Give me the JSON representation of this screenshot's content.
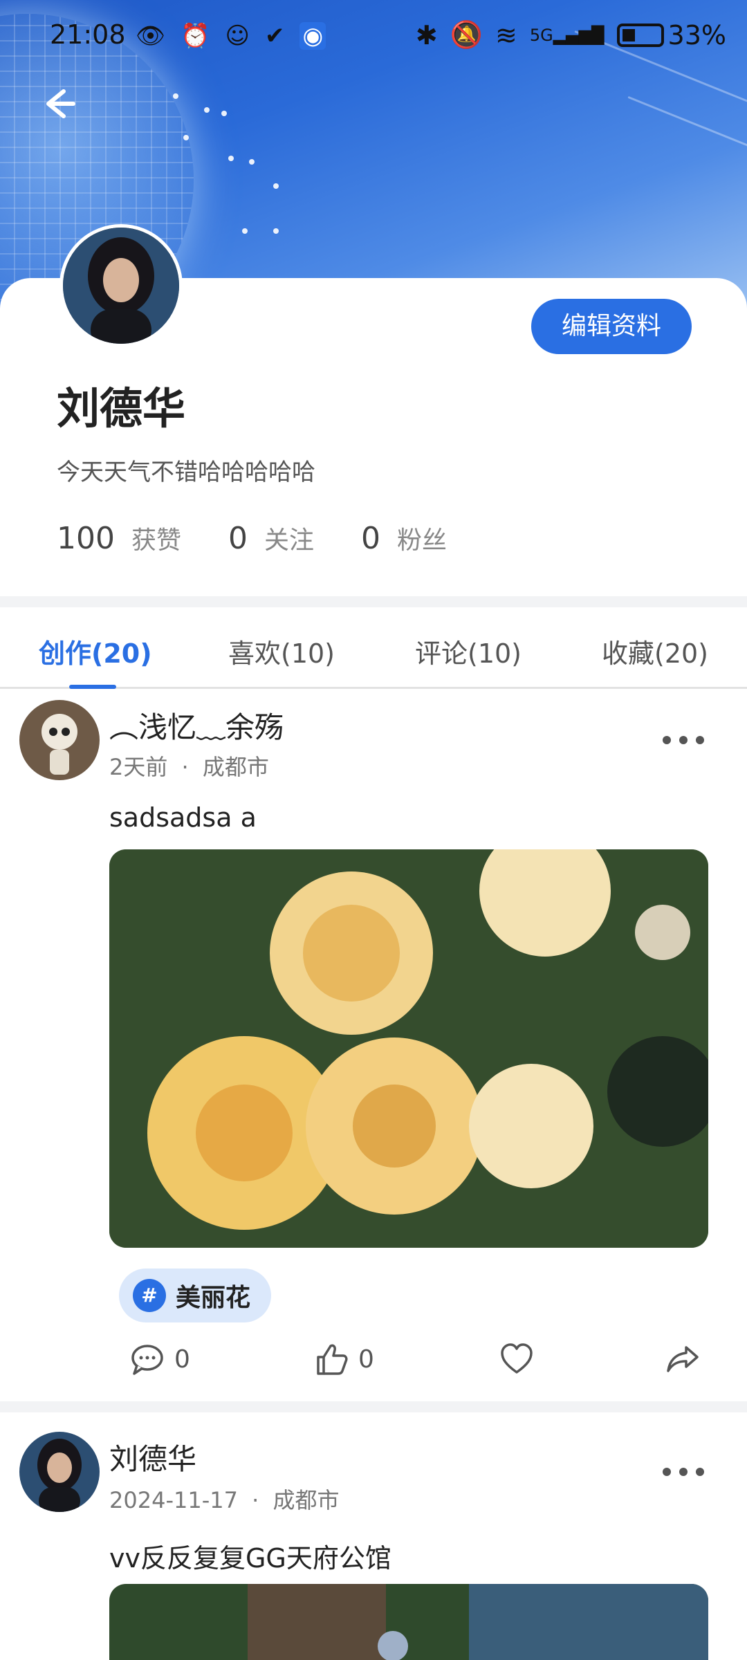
{
  "status_bar": {
    "time": "21:08",
    "battery": "33%",
    "network": "5G"
  },
  "header": {
    "back_icon": "back-arrow-icon",
    "accent_color": "#2a6fe3"
  },
  "profile": {
    "name": "刘德华",
    "bio": "今天天气不错哈哈哈哈哈",
    "edit_button": "编辑资料",
    "stats": [
      {
        "value": "100",
        "label": "获赞"
      },
      {
        "value": "0",
        "label": "关注"
      },
      {
        "value": "0",
        "label": "粉丝"
      }
    ]
  },
  "tabs": [
    {
      "label": "创作(20)",
      "active": true
    },
    {
      "label": "喜欢(10)",
      "active": false
    },
    {
      "label": "评论(10)",
      "active": false
    },
    {
      "label": "收藏(20)",
      "active": false
    }
  ],
  "posts": [
    {
      "author": "︵浅忆﹏余殇",
      "time": "2天前",
      "location": "成都市",
      "meta_sep": "·",
      "text": "sadsadsa a",
      "tag": "美丽花",
      "tag_icon": "#",
      "comments": "0",
      "likes": "0"
    },
    {
      "author": "刘德华",
      "time": "2024-11-17",
      "location": "成都市",
      "meta_sep": "·",
      "text": "vv反反复复GG天府公馆"
    }
  ]
}
